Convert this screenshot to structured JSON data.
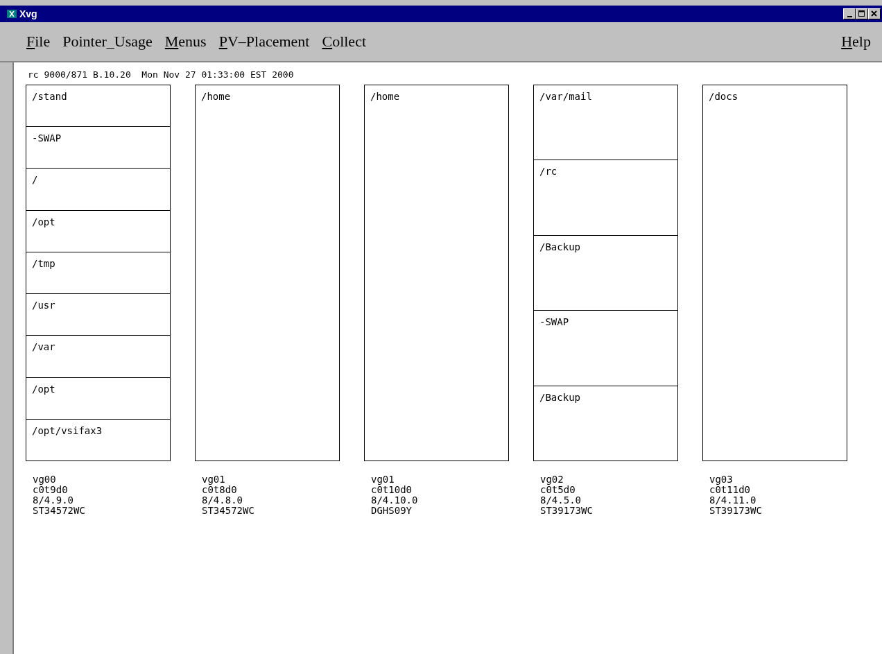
{
  "window": {
    "title": "Xvg"
  },
  "menus": [
    {
      "label": "File",
      "mnemonic": true
    },
    {
      "label": "Pointer_Usage",
      "mnemonic": false
    },
    {
      "label": "Menus",
      "mnemonic": true
    },
    {
      "label": "PV–Placement",
      "mnemonic": true
    },
    {
      "label": "Collect",
      "mnemonic": true
    }
  ],
  "help_menu": {
    "label": "Help",
    "mnemonic": true
  },
  "header": "rc 9000/871 B.10.20  Mon Nov 27 01:33:00 EST 2000",
  "disks": [
    {
      "volumes": [
        "/stand",
        "-SWAP",
        "/",
        "/opt",
        "/tmp",
        "/usr",
        "/var",
        "/opt",
        "/opt/vsifax3"
      ],
      "info": [
        "vg00",
        "c0t9d0",
        "8/4.9.0",
        "ST34572WC"
      ]
    },
    {
      "volumes": [
        "/home"
      ],
      "info": [
        "vg01",
        "c0t8d0",
        "8/4.8.0",
        "ST34572WC"
      ]
    },
    {
      "volumes": [
        "/home"
      ],
      "info": [
        "vg01",
        "c0t10d0",
        "8/4.10.0",
        "DGHS09Y"
      ]
    },
    {
      "volumes": [
        "/var/mail",
        "/rc",
        "/Backup",
        "-SWAP",
        "/Backup"
      ],
      "info": [
        "vg02",
        "c0t5d0",
        "8/4.5.0",
        "ST39173WC"
      ]
    },
    {
      "volumes": [
        "/docs"
      ],
      "info": [
        "vg03",
        "c0t11d0",
        "8/4.11.0",
        "ST39173WC"
      ]
    }
  ]
}
